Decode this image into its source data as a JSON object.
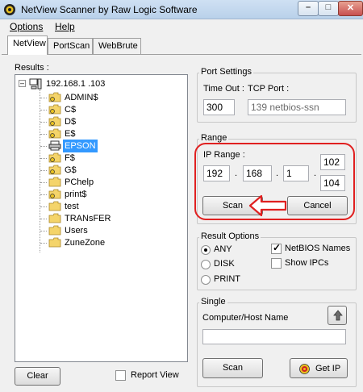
{
  "window": {
    "title": "NetView Scanner by Raw Logic Software"
  },
  "menu": [
    {
      "label": "Options",
      "accel": "O"
    },
    {
      "label": "Help",
      "accel": "H"
    }
  ],
  "tabs": [
    "NetView",
    "PortScan",
    "WebBrute"
  ],
  "results": {
    "label": "Results :",
    "host": "192.168.1  .103",
    "items": [
      "ADMIN$",
      "C$",
      "D$",
      "E$",
      "EPSON",
      "F$",
      "G$",
      "PChelp",
      "print$",
      "test",
      "TRANsFER",
      "Users",
      "ZuneZone"
    ],
    "selected": "EPSON"
  },
  "clear_button": "Clear",
  "report_view": {
    "label": "Report View",
    "checked": false
  },
  "port_settings": {
    "title": "Port Settings",
    "timeout_label": "Time Out :",
    "tcp_port_label": "TCP Port :",
    "timeout_value": "300",
    "tcp_port_value": "139   netbios-ssn"
  },
  "range": {
    "title": "Range",
    "ip_range_label": "IP Range :",
    "oct1": "192",
    "oct2": "168",
    "oct3": "1",
    "from": "102",
    "to": "104",
    "dot": ".",
    "scan_button": "Scan",
    "cancel_button": "Cancel"
  },
  "result_options": {
    "title": "Result Options",
    "radios": [
      {
        "label": "ANY",
        "checked": true
      },
      {
        "label": "DISK",
        "checked": false
      },
      {
        "label": "PRINT",
        "checked": false
      }
    ],
    "checkboxes": [
      {
        "label": "NetBIOS Names",
        "checked": true
      },
      {
        "label": "Show IPCs",
        "checked": false
      }
    ]
  },
  "single": {
    "title": "Single",
    "host_label": "Computer/Host Name",
    "host_value": "",
    "scan_button": "Scan",
    "get_ip_button": "Get IP"
  },
  "colors": {
    "annotation": "#e02020",
    "selection": "#3399ff"
  }
}
